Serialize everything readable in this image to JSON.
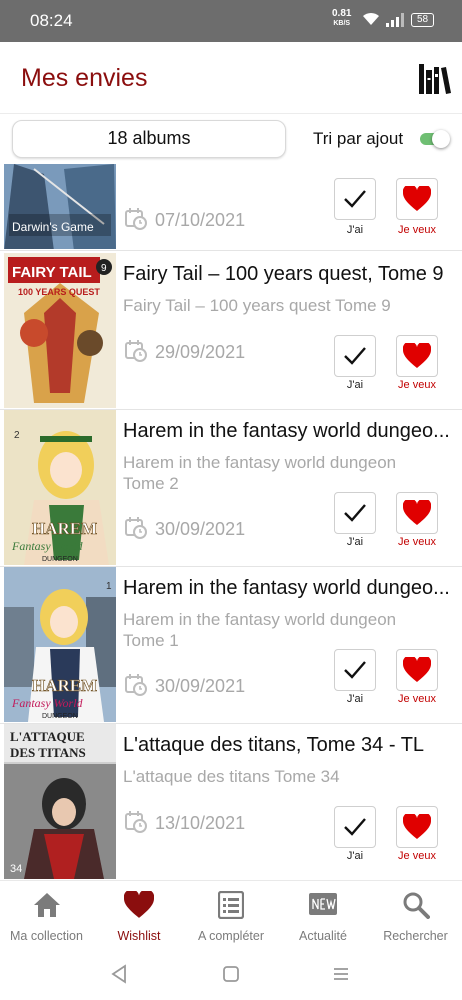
{
  "status_bar": {
    "time": "08:24",
    "net_speed": "0.81",
    "net_unit": "KB/S",
    "battery": "58"
  },
  "header": {
    "title": "Mes envies",
    "icon": "library-books-icon"
  },
  "filter": {
    "albums_count": "18 albums",
    "sort_label": "Tri par ajout",
    "sort_enabled": true
  },
  "colors": {
    "brand": "#8b0e0e",
    "heart": "#e00000",
    "toggle_on": "#4caf50",
    "muted_text": "#a8a8a8"
  },
  "items": [
    {
      "series": "",
      "subtitle": "",
      "date": "07/10/2021",
      "owned_label": "J'ai",
      "want_label": "Je veux",
      "cover": "Darwin's Game"
    },
    {
      "series": "Fairy Tail – 100 years quest, Tome 9",
      "subtitle": "Fairy Tail – 100 years quest Tome 9",
      "date": "29/09/2021",
      "owned_label": "J'ai",
      "want_label": "Je veux",
      "cover": "FAIRY TAIL 100 YEARS QUEST"
    },
    {
      "series": "Harem in the fantasy world dungeo...",
      "subtitle": "Harem in the fantasy world dungeon Tome 2",
      "date": "30/09/2021",
      "owned_label": "J'ai",
      "want_label": "Je veux",
      "cover": "HAREM Fantasy World DUNGEON"
    },
    {
      "series": "Harem in the fantasy world dungeo...",
      "subtitle": "Harem in the fantasy world dungeon Tome 1",
      "date": "30/09/2021",
      "owned_label": "J'ai",
      "want_label": "Je veux",
      "cover": "HAREM Fantasy World DUNGEON"
    },
    {
      "series": "L'attaque des titans, Tome 34 - TL",
      "subtitle": "L'attaque des titans Tome 34",
      "date": "13/10/2021",
      "owned_label": "J'ai",
      "want_label": "Je veux",
      "cover": "L'ATTAQUE DES TITANS"
    }
  ],
  "bottom_nav": [
    {
      "label": "Ma collection",
      "icon": "home-icon",
      "active": false
    },
    {
      "label": "Wishlist",
      "icon": "heart-icon",
      "active": true
    },
    {
      "label": "A compléter",
      "icon": "checklist-icon",
      "active": false
    },
    {
      "label": "Actualité",
      "icon": "new-badge-icon",
      "active": false
    },
    {
      "label": "Rechercher",
      "icon": "search-icon",
      "active": false
    }
  ],
  "cover_texts": {
    "darwin": "Darwin's Game",
    "ft_top": "FAIRY TAIL",
    "ft_sub": "100 YEARS QUEST",
    "ft_num": "9",
    "harem": "HAREM",
    "fw": "Fantasy World",
    "dungeon": "DUNGEON",
    "h2": "2",
    "h1": "1",
    "aot_1": "L'ATTAQUE",
    "aot_2": "DES TITANS",
    "aot_num": "34"
  }
}
